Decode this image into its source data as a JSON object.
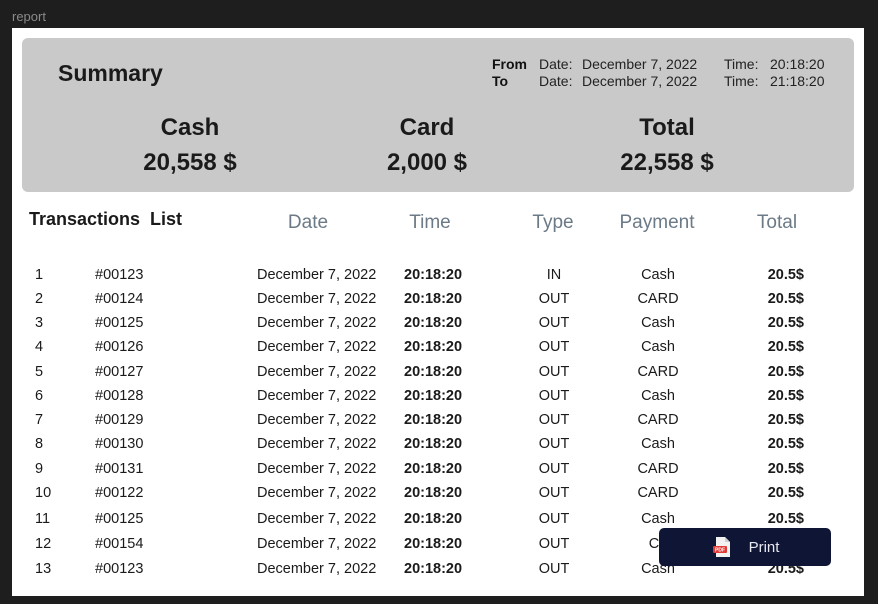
{
  "frame": {
    "label": "report"
  },
  "summary": {
    "title": "Summary",
    "range": {
      "from": {
        "dir": "From",
        "date_label": "Date:",
        "date": "December 7, 2022",
        "time_label": "Time:",
        "time": "20:18:20"
      },
      "to": {
        "dir": "To",
        "date_label": "Date:",
        "date": "December 7, 2022",
        "time_label": "Time:",
        "time": "21:18:20"
      }
    },
    "stats": [
      {
        "label": "Cash",
        "value": "20,558 $"
      },
      {
        "label": "Card",
        "value": "2,000 $"
      },
      {
        "label": "Total",
        "value": "22,558 $"
      }
    ]
  },
  "transactions": {
    "title": "Transactions  List",
    "columns": {
      "date": "Date",
      "time": "Time",
      "type": "Type",
      "payment": "Payment",
      "total": "Total"
    },
    "rows": [
      {
        "n": "1",
        "id": "#00123",
        "date": "December 7, 2022",
        "time": "20:18:20",
        "type": "IN",
        "payment": "Cash",
        "total": "20.5$"
      },
      {
        "n": "2",
        "id": "#00124",
        "date": "December 7, 2022",
        "time": "20:18:20",
        "type": "OUT",
        "payment": "CARD",
        "total": "20.5$"
      },
      {
        "n": "3",
        "id": "#00125",
        "date": "December 7, 2022",
        "time": "20:18:20",
        "type": "OUT",
        "payment": "Cash",
        "total": "20.5$"
      },
      {
        "n": "4",
        "id": "#00126",
        "date": "December 7, 2022",
        "time": "20:18:20",
        "type": "OUT",
        "payment": "Cash",
        "total": "20.5$"
      },
      {
        "n": "5",
        "id": "#00127",
        "date": "December 7, 2022",
        "time": "20:18:20",
        "type": "OUT",
        "payment": "CARD",
        "total": "20.5$"
      },
      {
        "n": "6",
        "id": "#00128",
        "date": "December 7, 2022",
        "time": "20:18:20",
        "type": "OUT",
        "payment": "Cash",
        "total": "20.5$"
      },
      {
        "n": "7",
        "id": "#00129",
        "date": "December 7, 2022",
        "time": "20:18:20",
        "type": "OUT",
        "payment": "CARD",
        "total": "20.5$"
      },
      {
        "n": "8",
        "id": "#00130",
        "date": "December 7, 2022",
        "time": "20:18:20",
        "type": "OUT",
        "payment": "Cash",
        "total": "20.5$"
      },
      {
        "n": "9",
        "id": "#00131",
        "date": "December 7, 2022",
        "time": "20:18:20",
        "type": "OUT",
        "payment": "CARD",
        "total": "20.5$"
      },
      {
        "n": "10",
        "id": "#00122",
        "date": "December 7, 2022",
        "time": "20:18:20",
        "type": "OUT",
        "payment": "CARD",
        "total": "20.5$"
      },
      {
        "n": "11",
        "id": "#00125",
        "date": "December 7, 2022",
        "time": "20:18:20",
        "type": "OUT",
        "payment": "Cash",
        "total": "20.5$"
      },
      {
        "n": "12",
        "id": "#00154",
        "date": "December 7, 2022",
        "time": "20:18:20",
        "type": "OUT",
        "payment": "Ca",
        "total": ""
      },
      {
        "n": "13",
        "id": "#00123",
        "date": "December 7, 2022",
        "time": "20:18:20",
        "type": "OUT",
        "payment": "Cash",
        "total": "20.5$"
      }
    ]
  },
  "print_button": {
    "label": "Print",
    "icon": "pdf-file-icon",
    "icon_text": "PDF"
  },
  "colors": {
    "accent": "#0f1535",
    "summary_bg": "#c9c9c9",
    "pdf_red": "#e53935"
  }
}
